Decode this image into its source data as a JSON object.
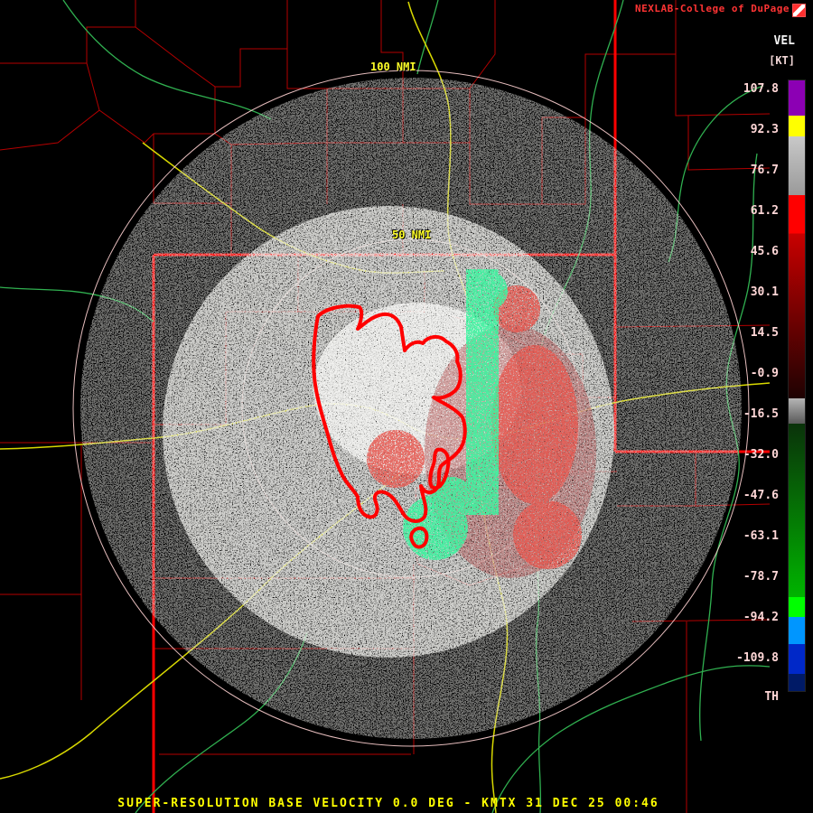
{
  "header": {
    "title": "NEXLAB-College of DuPage",
    "logo_icon": "cod-logo"
  },
  "scale": {
    "unit": "VEL",
    "unit_bracket": "[KT]",
    "labels": [
      "107.8",
      "92.3",
      "76.7",
      "61.2",
      "45.6",
      "30.1",
      "14.5",
      "-0.9",
      "-16.5",
      "-32.0",
      "-47.6",
      "-63.1",
      "-78.7",
      "-94.2",
      "-109.8"
    ],
    "threshold_label": "TH",
    "colorbar_colors_top_to_bottom": [
      "#8c00b4",
      "#ffff00",
      "#c8c8c8",
      "#ff0000",
      "#c80000",
      "#1e0202",
      "#b4b4b4",
      "#0a320a",
      "#00b400",
      "#00ff00",
      "#0096ff",
      "#0028c8",
      "#001a66"
    ]
  },
  "rings": {
    "outer_label": "100 NMI",
    "inner_label": "50 NMI"
  },
  "caption": "SUPER-RESOLUTION BASE VELOCITY 0.0 DEG - KMTX 31 DEC 25 00:46",
  "colors": {
    "background": "#000000",
    "county_boundary": "#b40000",
    "state_boundary": "#ff0000",
    "highway": "#d8d800",
    "river": "#30b050",
    "range_ring": "#ffd2d2",
    "caption_text": "#ffff00",
    "title_text": "#ff3434",
    "scale_text": "#ffd7d7",
    "warning_outline": "#ff0000"
  }
}
